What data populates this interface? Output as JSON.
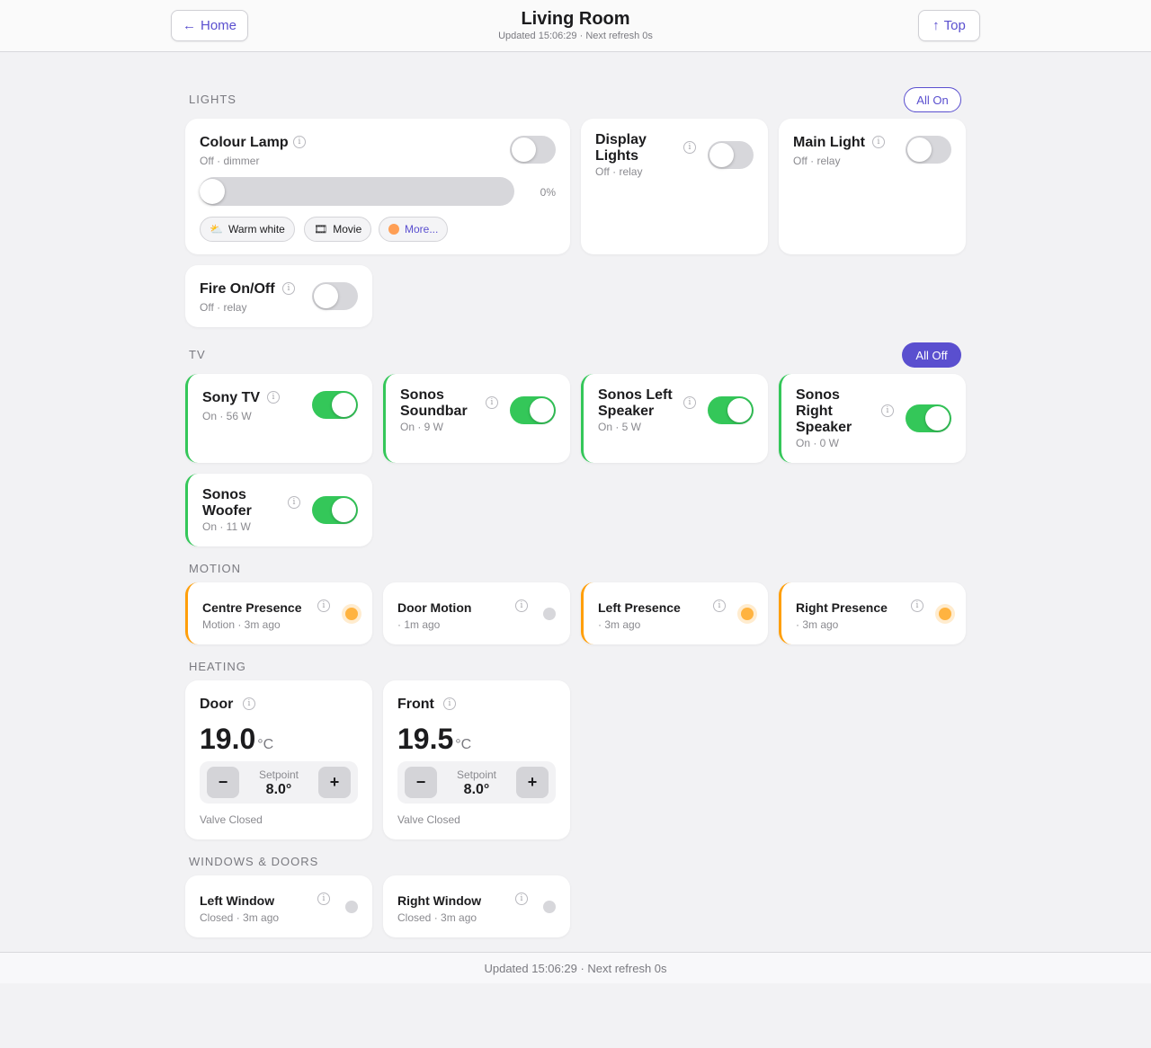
{
  "header": {
    "home_label": "Home",
    "top_label": "Top",
    "title": "Living Room",
    "status": "Updated 15:06:29 · Next refresh 0s"
  },
  "sections": {
    "lights": {
      "title": "LIGHTS",
      "action": "All On"
    },
    "tv": {
      "title": "TV",
      "action": "All Off"
    },
    "motion": {
      "title": "MOTION"
    },
    "heating": {
      "title": "HEATING"
    },
    "windows": {
      "title": "WINDOWS & DOORS"
    }
  },
  "lights": {
    "colour_lamp": {
      "name": "Colour Lamp",
      "meta": "Off · dimmer",
      "on": false,
      "level_percent": 0,
      "level_label": "0%",
      "presets": [
        "Warm white",
        "Movie",
        "More..."
      ]
    },
    "display_lights": {
      "name_line1": "Display",
      "name_line2": "Lights",
      "meta": "Off · relay",
      "on": false
    },
    "main_light": {
      "name": "Main Light",
      "meta": "Off · relay",
      "on": false
    },
    "fire": {
      "name": "Fire On/Off",
      "meta": "Off · relay",
      "on": false
    }
  },
  "tv": {
    "sony_tv": {
      "name": "Sony TV",
      "meta": "On · 56 W",
      "on": true
    },
    "soundbar": {
      "name_line1": "Sonos",
      "name_line2": "Soundbar",
      "meta": "On · 9 W",
      "on": true
    },
    "left_speaker": {
      "name_line1": "Sonos Left",
      "name_line2": "Speaker",
      "meta": "On · 5 W",
      "on": true
    },
    "right_speaker": {
      "name_line1": "Sonos",
      "name_line2": "Right",
      "name_line3": "Speaker",
      "meta": "On · 0 W",
      "on": true
    },
    "woofer": {
      "name_line1": "Sonos",
      "name_line2": "Woofer",
      "meta": "On · 11 W",
      "on": true
    }
  },
  "motion": {
    "centre": {
      "name": "Centre Presence",
      "meta": "Motion · 3m ago",
      "active": true
    },
    "door": {
      "name": "Door Motion",
      "meta": "· 1m ago",
      "active": false
    },
    "left": {
      "name": "Left Presence",
      "meta": "· 3m ago",
      "active": true
    },
    "right": {
      "name": "Right Presence",
      "meta": "· 3m ago",
      "active": true
    }
  },
  "heating": {
    "door": {
      "name": "Door",
      "temp": "19.0",
      "unit": "°C",
      "setpoint_label": "Setpoint",
      "setpoint": "8.0°",
      "valve": "Valve Closed"
    },
    "front": {
      "name": "Front",
      "temp": "19.5",
      "unit": "°C",
      "setpoint_label": "Setpoint",
      "setpoint": "8.0°",
      "valve": "Valve Closed"
    }
  },
  "windows": {
    "left": {
      "name": "Left Window",
      "meta": "Closed · 3m ago"
    },
    "right": {
      "name": "Right Window",
      "meta": "Closed · 3m ago"
    }
  },
  "footer": {
    "status": "Updated 15:06:29 · Next refresh 0s"
  },
  "colors": {
    "accent": "#5a4fcf",
    "on": "#34c759",
    "motion": "#ff9f0a",
    "off": "#d7d7db"
  }
}
